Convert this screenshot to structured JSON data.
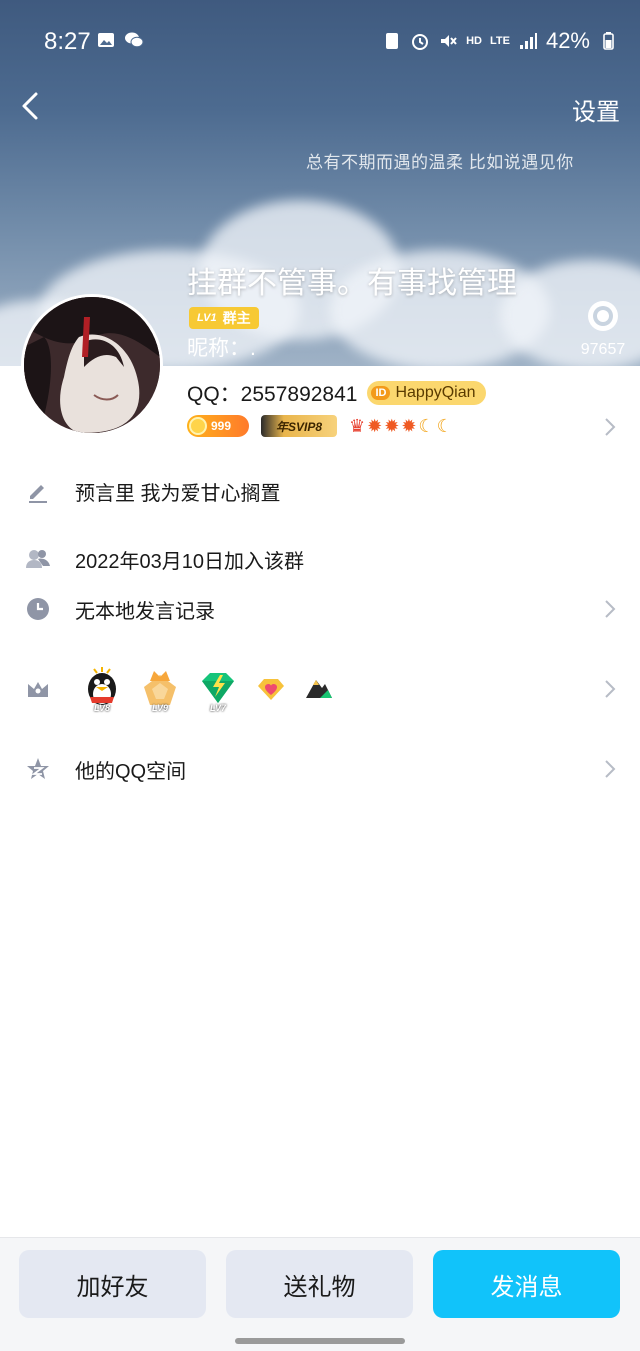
{
  "status_bar": {
    "time": "8:27",
    "network": "LTE",
    "hd": "HD",
    "battery": "42%",
    "left_icons": [
      "image-icon",
      "wechat-icon"
    ],
    "right_icons": [
      "storage-icon",
      "alarm-icon",
      "mute-icon",
      "signal-icon",
      "battery-icon"
    ]
  },
  "header": {
    "settings_label": "设置",
    "banner_quote": "总有不期而遇的温柔  比如说遇见你",
    "group_name": "挂群不管事。有事找管理",
    "level_badge": {
      "lv": "LV1",
      "role": "群主"
    },
    "nickname": "昵称：.",
    "like_count": "97657"
  },
  "profile": {
    "qq_label": "QQ：2557892841",
    "id_tag": "ID",
    "id_name": "HappyQian",
    "coin_value": "999",
    "svip_label": "年SVIP8",
    "level_icons": [
      "crown",
      "sun",
      "sun",
      "sun",
      "moon",
      "moon"
    ]
  },
  "rows": {
    "signature": "预言里 我为爱甘心搁置",
    "joined": "2022年03月10日加入该群",
    "history": "无本地发言记录",
    "qzone": "他的QQ空间"
  },
  "medals": [
    {
      "name": "penguin",
      "level": "LV8"
    },
    {
      "name": "crown",
      "level": "LV9"
    },
    {
      "name": "diamond",
      "level": "LV7"
    },
    {
      "name": "heart-gem",
      "level": ""
    },
    {
      "name": "mountain",
      "level": ""
    }
  ],
  "bottom_actions": {
    "add_friend": "加好友",
    "send_gift": "送礼物",
    "send_message": "发消息"
  },
  "colors": {
    "primary": "#11c3fa",
    "secondary_button": "#e4e8f2",
    "level_badge": "#f7c934"
  }
}
